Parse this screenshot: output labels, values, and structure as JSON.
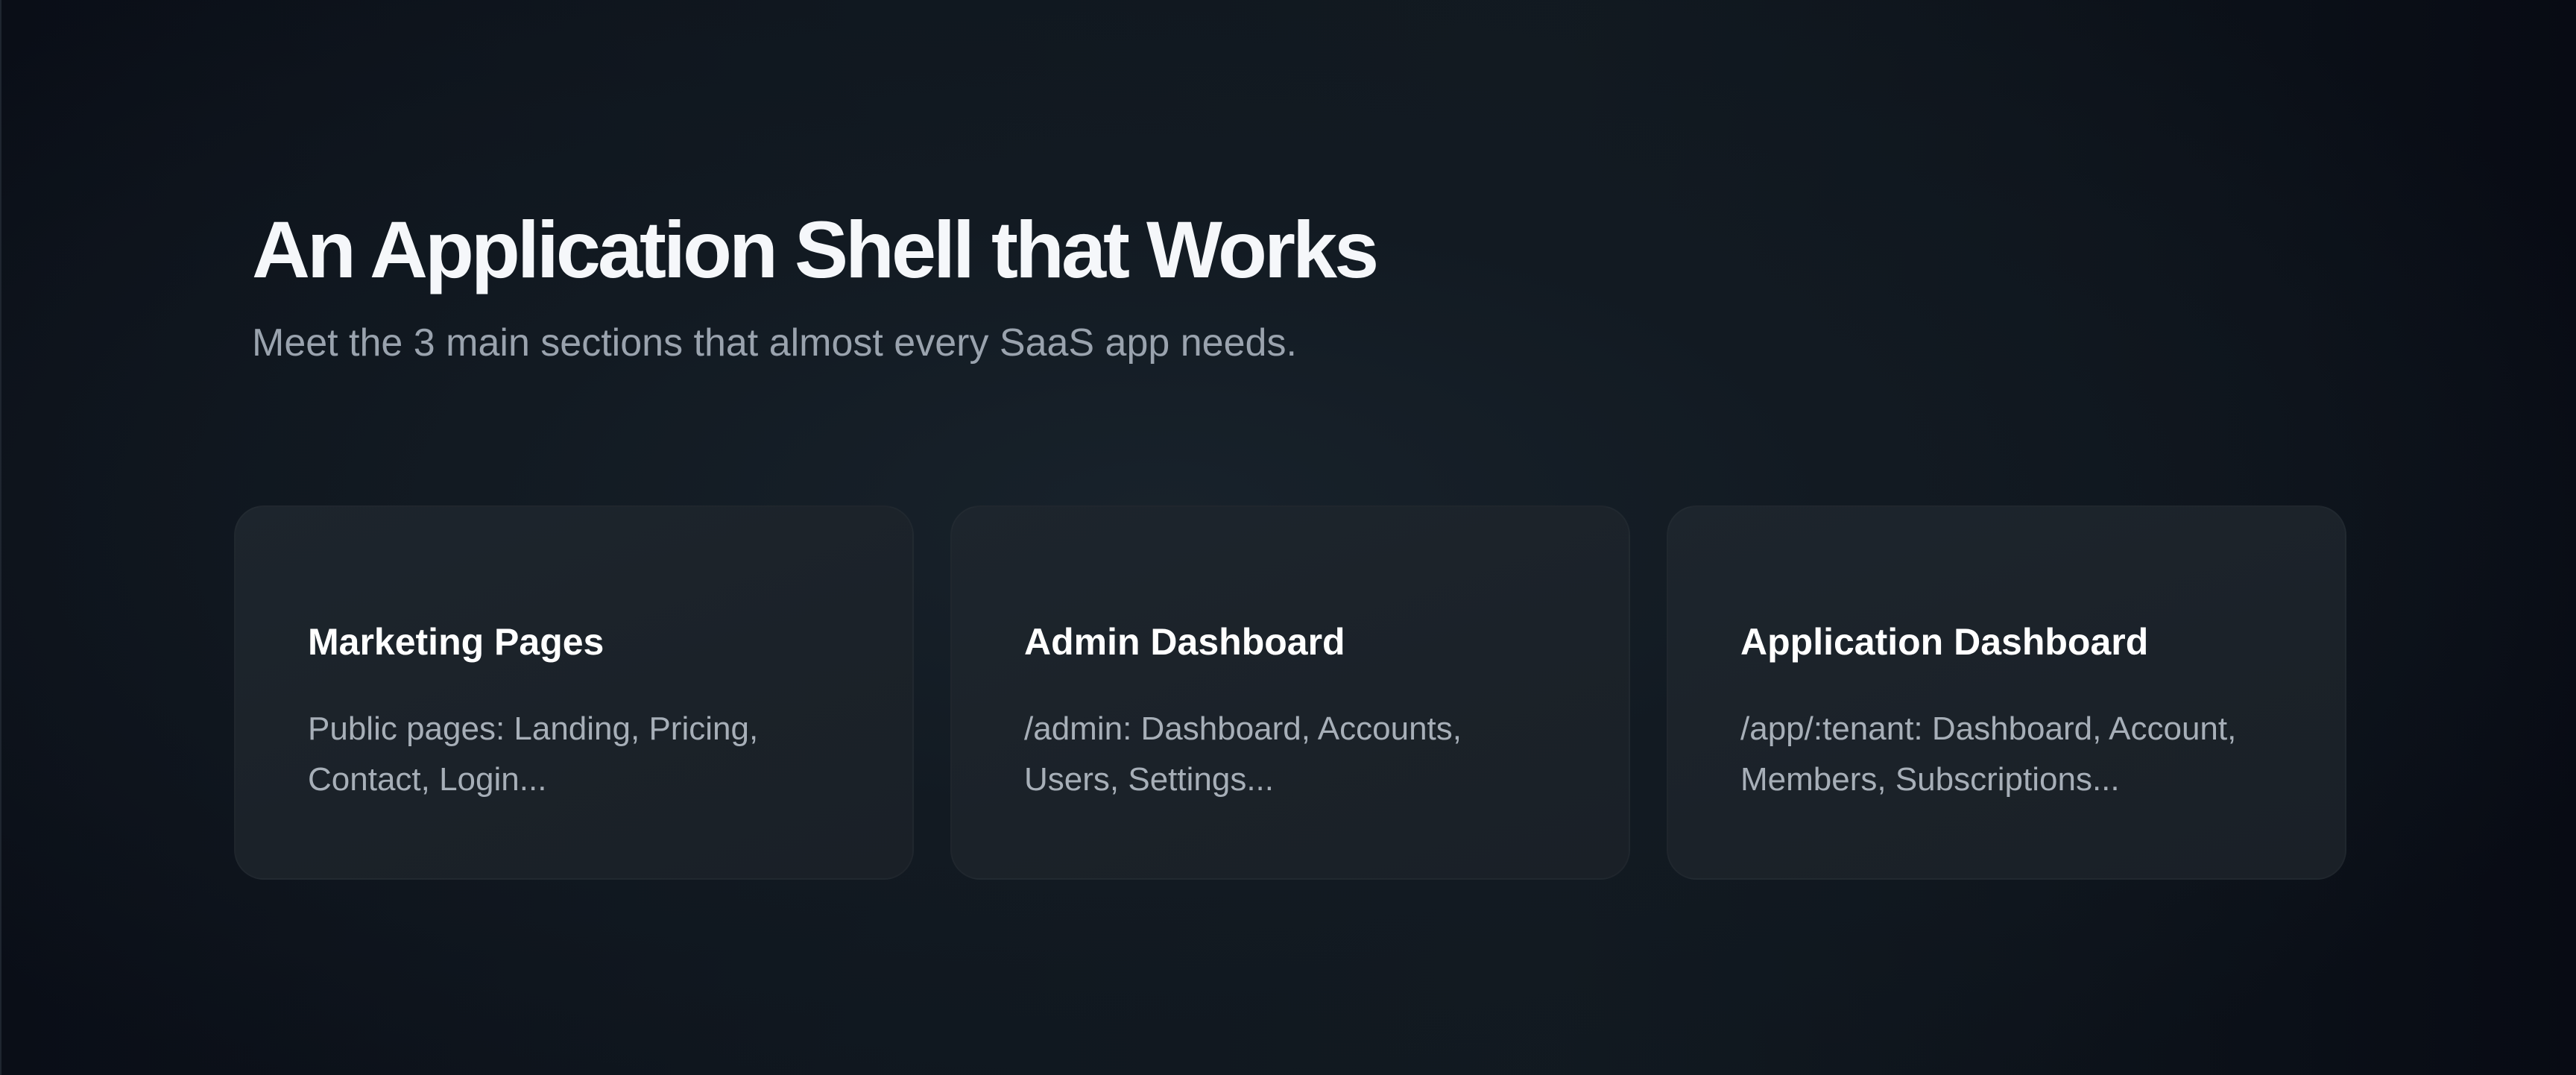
{
  "hero": {
    "title": "An Application Shell that Works",
    "subtitle": "Meet the 3 main sections that almost every SaaS app needs."
  },
  "cards": [
    {
      "title": "Marketing Pages",
      "description": "Public pages: Landing, Pricing, Contact, Login..."
    },
    {
      "title": "Admin Dashboard",
      "description": "/admin: Dashboard, Accounts, Users, Settings..."
    },
    {
      "title": "Application Dashboard",
      "description": "/app/:tenant: Dashboard, Account, Members, Subscriptions..."
    }
  ],
  "colors": {
    "background": "#0e141b",
    "card_background": "#1c232b",
    "title_text": "#f5f7fa",
    "subtitle_text": "#9aa3ae",
    "card_title_text": "#ffffff",
    "card_description_text": "#a7afb8"
  }
}
